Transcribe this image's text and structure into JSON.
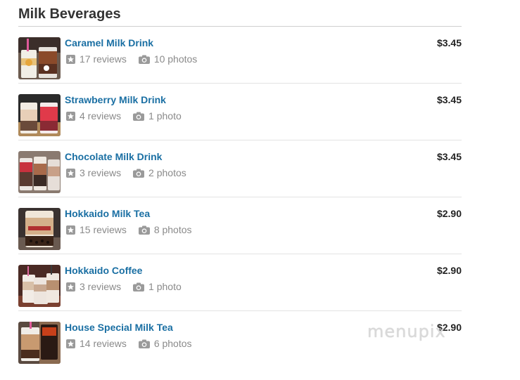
{
  "section": {
    "title": "Milk Beverages"
  },
  "items": [
    {
      "name": "Caramel Milk Drink",
      "reviews": "17 reviews",
      "photos": "10 photos",
      "price": "$3.45"
    },
    {
      "name": "Strawberry Milk Drink",
      "reviews": "4 reviews",
      "photos": "1 photo",
      "price": "$3.45"
    },
    {
      "name": "Chocolate Milk Drink",
      "reviews": "3 reviews",
      "photos": "2 photos",
      "price": "$3.45"
    },
    {
      "name": "Hokkaido Milk Tea",
      "reviews": "15 reviews",
      "photos": "8 photos",
      "price": "$2.90"
    },
    {
      "name": "Hokkaido Coffee",
      "reviews": "3 reviews",
      "photos": "1 photo",
      "price": "$2.90"
    },
    {
      "name": "House Special Milk Tea",
      "reviews": "14 reviews",
      "photos": "6 photos",
      "price": "$2.90"
    }
  ],
  "watermark": "menupix",
  "icons": {
    "reviews": "star-icon",
    "photos": "camera-icon"
  },
  "colors": {
    "link": "#1a6fa3",
    "meta": "#8a8a8a",
    "price": "#222222"
  }
}
